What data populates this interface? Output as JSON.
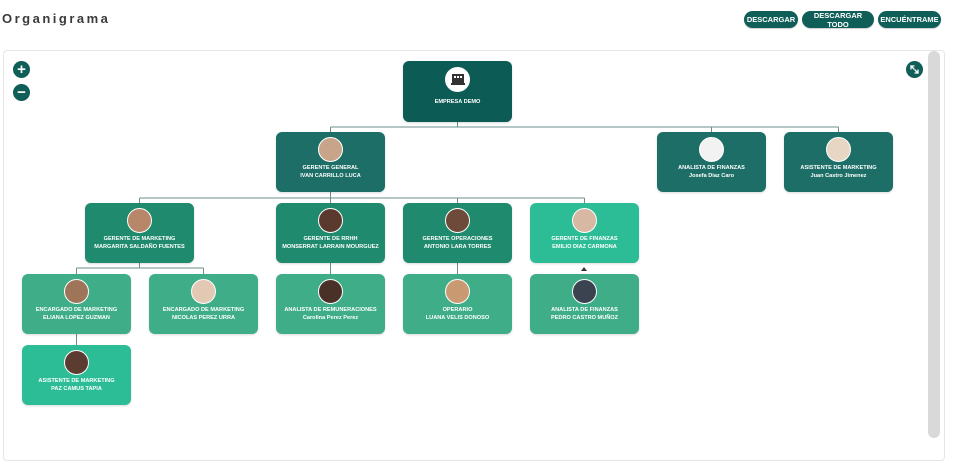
{
  "header": {
    "title": "Organigrama",
    "buttons": {
      "descargar": "DESCARGAR",
      "descargar_todo": "DESCARGAR TODO",
      "encuentrame": "ENCUÉNTRAME"
    }
  },
  "zoom": {
    "in_symbol": "+",
    "out_symbol": "−"
  },
  "colors": {
    "dark": "#0d5b55",
    "teal": "#1c6e67",
    "green": "#1f8a6d",
    "mid": "#3fae88",
    "light": "#2dbd96",
    "button": "#0f5e58"
  },
  "org": {
    "empresa": {
      "role": "EMPRESA DEMO",
      "name": ""
    },
    "gerente_general": {
      "role": "GERENTE GENERAL",
      "name": "IVAN CARRILLO LUCA"
    },
    "analista_finanzas_top": {
      "role": "ANALISTA DE FINANZAS",
      "name": "Josefa Diaz Caro"
    },
    "asistente_marketing_top": {
      "role": "ASISTENTE DE MARKETING",
      "name": "Juan Castro Jimenez"
    },
    "gerente_marketing": {
      "role": "GERENTE DE MARKETING",
      "name": "MARGARITA SALDAÑO FUENTES"
    },
    "gerente_rrhh": {
      "role": "GERENTE DE RRHH",
      "name": "MONSERRAT LARRAIN MOURGUEZ"
    },
    "gerente_operaciones": {
      "role": "GERENTE OPERACIONES",
      "name": "ANTONIO LARA TORRES"
    },
    "gerente_finanzas": {
      "role": "GERENTE DE FINANZAS",
      "name": "EMILIO DIAZ CARMONA"
    },
    "encargado_marketing_1": {
      "role": "ENCARGADO DE MARKETING",
      "name": "ELIANA LOPEZ GUZMAN"
    },
    "encargado_marketing_2": {
      "role": "ENCARGADO DE MARKETING",
      "name": "NICOLAS PEREZ URRA"
    },
    "analista_remuneraciones": {
      "role": "ANALISTA DE REMUNERACIONES",
      "name": "Carolina Perez Perez"
    },
    "operario": {
      "role": "OPERARIO",
      "name": "LUANA VELIS DONOSO"
    },
    "analista_finanzas_bottom": {
      "role": "ANALISTA DE FINANZAS",
      "name": "PEDRO CASTRO MUÑOZ"
    },
    "asistente_marketing_bottom": {
      "role": "ASISTENTE DE MARKETING",
      "name": "PAZ CAMUS TAPIA"
    }
  }
}
